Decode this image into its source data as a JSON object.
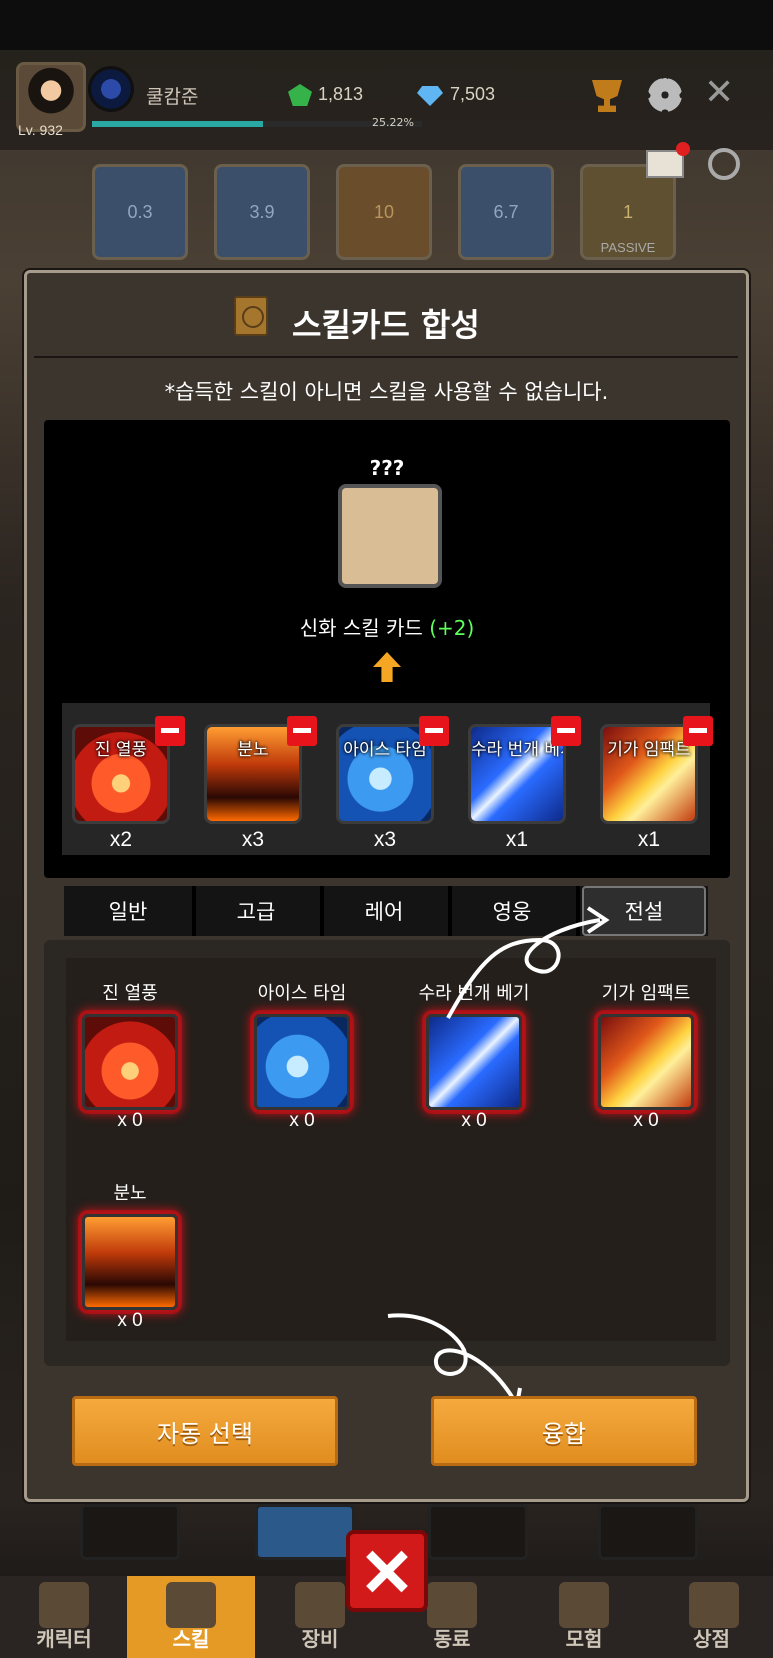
{
  "hud": {
    "level": "Lv. 932",
    "player_name": "쿨캄준",
    "exp_percent_label": "25.22%",
    "exp_fraction": 0.2522,
    "green_gems": "1,813",
    "diamonds": "7,503"
  },
  "skill_slots": [
    {
      "value": "0.3"
    },
    {
      "value": "3.9"
    },
    {
      "value": "10"
    },
    {
      "value": "6.7"
    },
    {
      "value": "1",
      "tag": "PASSIVE"
    }
  ],
  "panel": {
    "title": "스킬카드 합성",
    "notice": "*습득한 스킬이 아니면 스킬을 사용할 수 없습니다.",
    "result_name": "???",
    "result_card_label": "신화 스킬 카드",
    "result_card_bonus": "(+2)"
  },
  "selected": [
    {
      "name": "진 열풍",
      "count": "x2",
      "art": "fire"
    },
    {
      "name": "분노",
      "count": "x3",
      "art": "rage"
    },
    {
      "name": "아이스 타임",
      "count": "x3",
      "art": "ice"
    },
    {
      "name": "수라 번개 베기",
      "count": "x1",
      "art": "bolt"
    },
    {
      "name": "기가 임팩트",
      "count": "x1",
      "art": "giga"
    }
  ],
  "tabs": [
    "일반",
    "고급",
    "레어",
    "영웅",
    "전설"
  ],
  "active_tab": "전설",
  "inventory": [
    {
      "name": "진 열풍",
      "count": "x 0",
      "art": "fire"
    },
    {
      "name": "아이스 타임",
      "count": "x 0",
      "art": "ice"
    },
    {
      "name": "수라 번개 베기",
      "count": "x 0",
      "art": "bolt"
    },
    {
      "name": "기가 임팩트",
      "count": "x 0",
      "art": "giga"
    },
    {
      "name": "분노",
      "count": "x 0",
      "art": "rage"
    }
  ],
  "buttons": {
    "auto_select": "자동 선택",
    "fuse": "융합"
  },
  "bottom_nav": [
    {
      "label": "캐릭터",
      "icon": "exp-icon"
    },
    {
      "label": "스킬",
      "icon": "skill-book-icon"
    },
    {
      "label": "장비",
      "icon": "swords-icon"
    },
    {
      "label": "동료",
      "icon": "companion-icon"
    },
    {
      "label": "모험",
      "icon": "tree-icon"
    },
    {
      "label": "상점",
      "icon": "treasure-bag-icon"
    }
  ],
  "colors": {
    "accent_orange": "#e59a25",
    "bonus_green": "#5dff5d",
    "remove_red": "#e8141b",
    "legend_glow": "#c2141b"
  }
}
